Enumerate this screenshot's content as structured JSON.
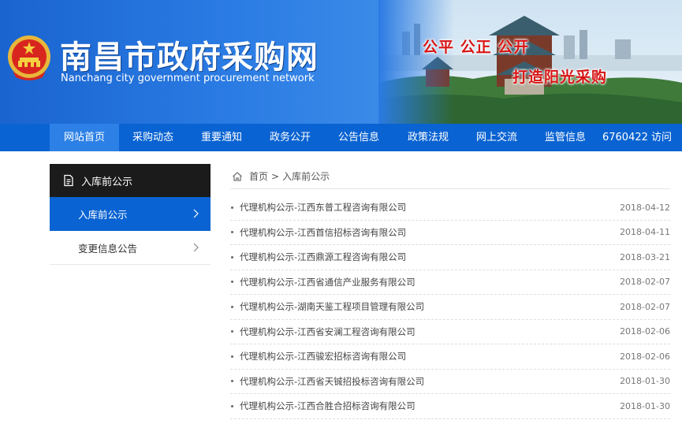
{
  "header": {
    "title": "南昌市政府采购网",
    "subtitle": "Nanchang city government procurement network",
    "slogan_line1": "公平 公正 公开",
    "slogan_line2": "打造阳光采购"
  },
  "nav": {
    "items": [
      {
        "label": "网站首页"
      },
      {
        "label": "采购动态"
      },
      {
        "label": "重要通知"
      },
      {
        "label": "政务公开"
      },
      {
        "label": "公告信息"
      },
      {
        "label": "政策法规"
      },
      {
        "label": "网上交流"
      },
      {
        "label": "监管信息"
      }
    ],
    "visit_count": "6760422 访问",
    "active_index": 0
  },
  "sidebar": {
    "heading": "入库前公示",
    "items": [
      {
        "label": "入库前公示"
      },
      {
        "label": "变更信息公告"
      }
    ],
    "active_index": 0
  },
  "breadcrumb": {
    "home": "首页",
    "separator": ">",
    "current": "入库前公示"
  },
  "articles": [
    {
      "title": "代理机构公示-江西东普工程咨询有限公司",
      "date": "2018-04-12"
    },
    {
      "title": "代理机构公示-江西首信招标咨询有限公司",
      "date": "2018-04-11"
    },
    {
      "title": "代理机构公示-江西鼎源工程咨询有限公司",
      "date": "2018-03-21"
    },
    {
      "title": "代理机构公示-江西省通信产业服务有限公司",
      "date": "2018-02-07"
    },
    {
      "title": "代理机构公示-湖南天鉴工程项目管理有限公司",
      "date": "2018-02-07"
    },
    {
      "title": "代理机构公示-江西省安澜工程咨询有限公司",
      "date": "2018-02-06"
    },
    {
      "title": "代理机构公示-江西骏宏招标咨询有限公司",
      "date": "2018-02-06"
    },
    {
      "title": "代理机构公示-江西省天铖招投标咨询有限公司",
      "date": "2018-01-30"
    },
    {
      "title": "代理机构公示-江西合胜合招标咨询有限公司",
      "date": "2018-01-30"
    }
  ],
  "colors": {
    "header_blue": "#1f6fd6",
    "nav_blue": "#0a63d2",
    "nav_active": "#2d81e6",
    "sidebar_head": "#1b1b1b",
    "slogan_red": "#d81414"
  },
  "icons": {
    "emblem": "national-emblem-icon",
    "sidebar_head": "document-icon",
    "breadcrumb": "home-icon",
    "chevron": "chevron-right-icon"
  }
}
